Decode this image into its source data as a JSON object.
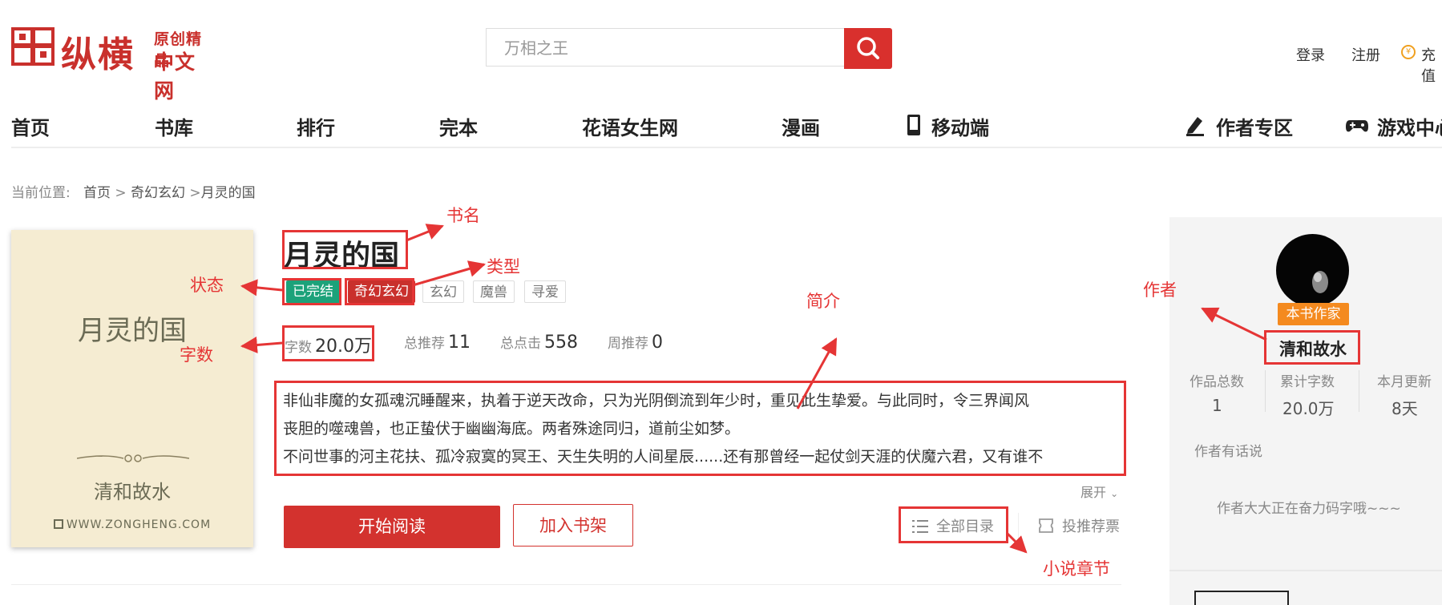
{
  "header": {
    "logo": {
      "main": "纵横",
      "sub_top": "原创精品",
      "sub_bottom": "中文网"
    },
    "search": {
      "placeholder": "万相之王"
    },
    "login": "登录",
    "register": "注册",
    "recharge": "充值"
  },
  "nav": {
    "items": [
      "首页",
      "书库",
      "排行",
      "完本",
      "花语女生网",
      "漫画",
      "移动端",
      "作者专区",
      "游戏中心"
    ]
  },
  "breadcrumb": {
    "label": "当前位置:",
    "home": "首页",
    "sep1": ">",
    "category": "奇幻玄幻",
    "sep2": ">",
    "book": "月灵的国"
  },
  "cover": {
    "title": "月灵的国",
    "author": "清和故水",
    "url": "WWW.ZONGHENG.COM"
  },
  "book": {
    "title": "月灵的国",
    "status": "已完结",
    "category": "奇幻玄幻",
    "tags": [
      "玄幻",
      "魔兽",
      "寻爱"
    ],
    "stats": {
      "words_label": "字数",
      "words": "20.0万",
      "recommend_label": "总推荐",
      "recommend": "11",
      "clicks_label": "总点击",
      "clicks": "558",
      "weekly_label": "周推荐",
      "weekly": "0"
    },
    "intro": [
      "非仙非魔的女孤魂沉睡醒来，执着于逆天改命，只为光阴倒流到年少时，重见此生挚爱。与此同时，令三界闻风",
      "丧胆的噬魂兽，也正蛰伏于幽幽海底。两者殊途同归，道前尘如梦。",
      "不问世事的河主花扶、孤冷寂寞的冥王、天生失明的人间星辰......还有那曾经一起仗剑天涯的伏魔六君，又有谁不"
    ],
    "expand": "展开",
    "read_button": "开始阅读",
    "shelf_button": "加入书架",
    "catalog": "全部目录",
    "vote": "投推荐票"
  },
  "author": {
    "badge": "本书作家",
    "name": "清和故水",
    "works_label": "作品总数",
    "works": "1",
    "words_label": "累计字数",
    "words": "20.0万",
    "month_label": "本月更新",
    "month": "8天",
    "say_label": "作者有话说",
    "message": "作者大大正在奋力码字哦~~~"
  },
  "annotations": {
    "book_name": "书名",
    "type": "类型",
    "status": "状态",
    "intro": "简介",
    "author": "作者",
    "words": "字数",
    "chapters": "小说章节"
  },
  "colors": {
    "brand_red": "#c9302c",
    "status_green": "#1ca27a",
    "badge_orange": "#f48a1f",
    "annotation_red": "#e53535"
  }
}
